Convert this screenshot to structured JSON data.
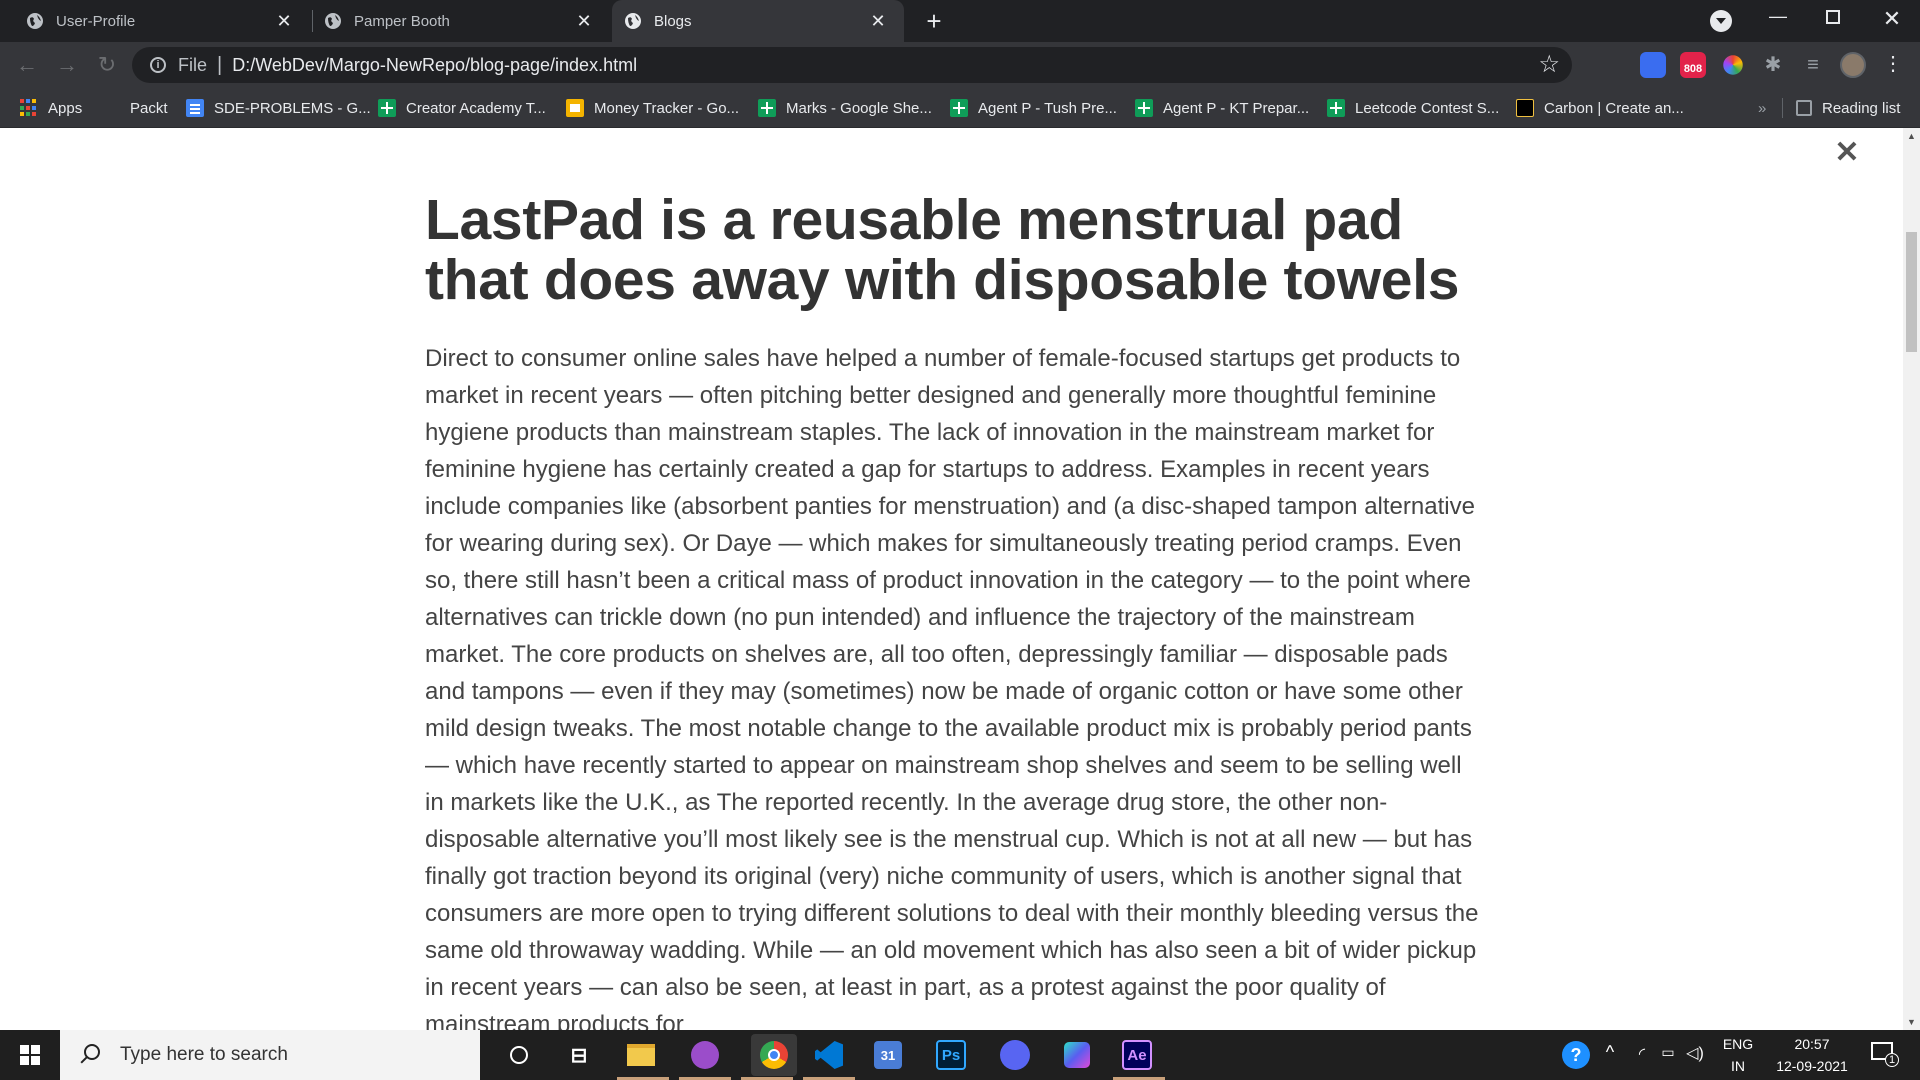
{
  "tabs": [
    {
      "title": "User-Profile",
      "active": false
    },
    {
      "title": "Pamper Booth",
      "active": false
    },
    {
      "title": "Blogs",
      "active": true
    }
  ],
  "toolbar": {
    "scheme": "File",
    "url": "D:/WebDev/Margo-NewRepo/blog-page/index.html",
    "ext_badge": "808"
  },
  "bookmarks": [
    {
      "label": "Apps",
      "icon": "apps-grid-icon"
    },
    {
      "label": "Packt",
      "icon": "none"
    },
    {
      "label": "SDE-PROBLEMS - G...",
      "icon": "docs-icon"
    },
    {
      "label": "Creator Academy T...",
      "icon": "sheets-icon"
    },
    {
      "label": "Money Tracker - Go...",
      "icon": "slides-icon"
    },
    {
      "label": "Marks - Google She...",
      "icon": "sheets-icon"
    },
    {
      "label": "Agent P - Tush Pre...",
      "icon": "sheets-icon"
    },
    {
      "label": "Agent P - KT Prepar...",
      "icon": "sheets-icon"
    },
    {
      "label": "Leetcode Contest S...",
      "icon": "sheets-icon"
    },
    {
      "label": "Carbon | Create an...",
      "icon": "carbon-icon"
    }
  ],
  "reading_list": "Reading list",
  "article": {
    "title": "LastPad is a reusable menstrual pad that does away with disposable towels",
    "body": "Direct to consumer online sales have helped a number of female-focused startups get products to market in recent years — often pitching better designed and generally more thoughtful feminine hygiene products than mainstream staples. The lack of innovation in the mainstream market for feminine hygiene has certainly created a gap for startups to address. Examples in recent years include companies like (absorbent panties for menstruation) and (a disc-shaped tampon alternative for wearing during sex). Or Daye — which makes for simultaneously treating period cramps. Even so, there still hasn’t been a critical mass of product innovation in the category — to the point where alternatives can trickle down (no pun intended) and influence the trajectory of the mainstream market. The core products on shelves are, all too often, depressingly familiar — disposable pads and tampons — even if they may (sometimes) now be made of organic cotton or have some other mild design tweaks. The most notable change to the available product mix is probably period pants — which have recently started to appear on mainstream shop shelves and seem to be selling well in markets like the U.K., as The reported recently. In the average drug store, the other non-disposable alternative you’ll most likely see is the menstrual cup. Which is not at all new — but has finally got traction beyond its original (very) niche community of users, which is another signal that consumers are more open to trying different solutions to deal with their monthly bleeding versus the same old throwaway wadding. While — an old movement which has also seen a bit of wider pickup in recent years — can also be seen, at least in part, as a protest against the poor quality of mainstream products for"
  },
  "taskbar": {
    "search_placeholder": "Type here to search",
    "calendar_day": "31",
    "ps_label": "Ps",
    "ae_label": "Ae",
    "lang_top": "ENG",
    "lang_bottom": "IN",
    "time": "20:57",
    "date": "12-09-2021",
    "notification_count": "1"
  }
}
